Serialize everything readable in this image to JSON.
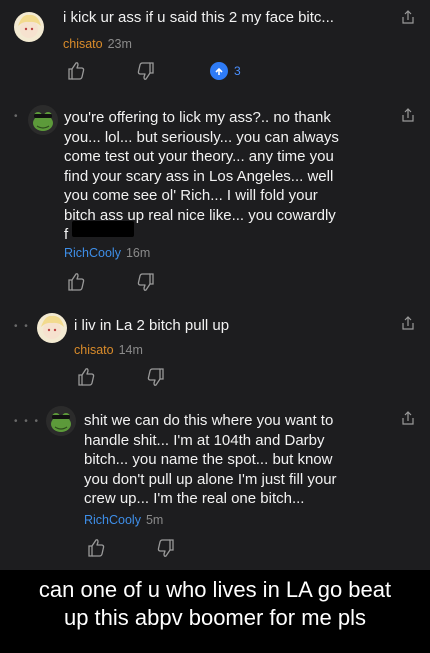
{
  "comments": [
    {
      "author": "chisato",
      "time": "23m",
      "text": "i kick ur ass if u said this 2 my face bitc...",
      "reply_count": "3"
    },
    {
      "author": "RichCooly",
      "time": "16m",
      "text": "you're offering to lick my ass?.. no thank\nyou... lol... but seriously... you can always\ncome test out your theory... any time you\nfind your scary ass in Los Angeles... well\nyou come see ol' Rich... I will fold your\nbitch ass up real nice like... you cowardly\nf"
    },
    {
      "author": "chisato",
      "time": "14m",
      "text": "i liv in La 2 bitch pull up"
    },
    {
      "author": "RichCooly",
      "time": "5m",
      "text": "shit we can do this where you want to\nhandle shit... I'm at 104th and Darby\nbitch... you name the spot... but know\nyou don't pull up alone I'm just fill your\ncrew up... I'm the real one bitch..."
    }
  ],
  "caption": "can one of u who lives in LA go beat\nup this abpv boomer for me pls",
  "colors": {
    "background": "#1d1d1f",
    "chisato": "#d98b2a",
    "richcooly": "#3e8ee8",
    "reply_badge": "#2e7bf6"
  },
  "icons": [
    "upvote-icon",
    "downvote-icon",
    "share-icon",
    "reply-count-icon"
  ]
}
